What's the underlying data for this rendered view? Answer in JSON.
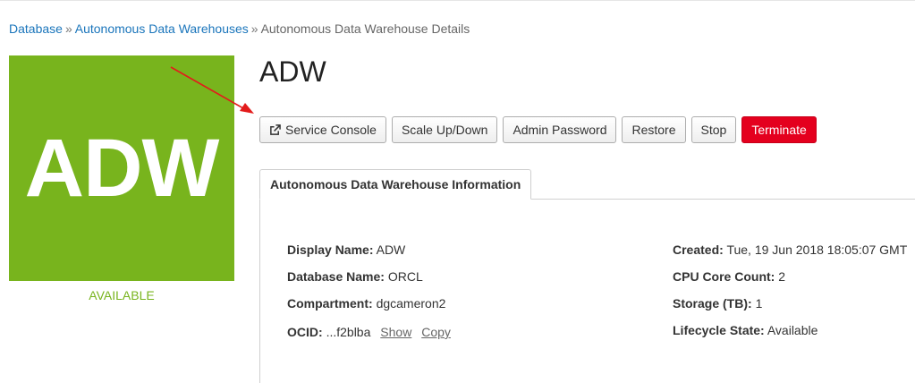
{
  "breadcrumb": {
    "items": [
      "Database",
      "Autonomous Data Warehouses"
    ],
    "separator": "»",
    "current": "Autonomous Data Warehouse Details"
  },
  "tile": {
    "abbr": "ADW",
    "color": "#78b41d"
  },
  "status": {
    "text": "AVAILABLE",
    "color": "#78b41d"
  },
  "title": "ADW",
  "actions": {
    "service_console": "Service Console",
    "scale": "Scale Up/Down",
    "admin_password": "Admin Password",
    "restore": "Restore",
    "stop": "Stop",
    "terminate": "Terminate",
    "terminate_color": "#e4001e"
  },
  "tab": {
    "label": "Autonomous Data Warehouse Information"
  },
  "info": {
    "display_name": {
      "label": "Display Name:",
      "value": "ADW"
    },
    "database_name": {
      "label": "Database Name:",
      "value": "ORCL"
    },
    "compartment": {
      "label": "Compartment:",
      "value": "dgcameron2"
    },
    "ocid": {
      "label": "OCID:",
      "value": "...f2blba",
      "show": "Show",
      "copy": "Copy"
    },
    "created": {
      "label": "Created:",
      "value": "Tue, 19 Jun 2018 18:05:07 GMT"
    },
    "cpu_core_count": {
      "label": "CPU Core Count:",
      "value": "2"
    },
    "storage": {
      "label": "Storage (TB):",
      "value": "1"
    },
    "lifecycle_state": {
      "label": "Lifecycle State:",
      "value": "Available"
    }
  },
  "annotation": {
    "arrow_color": "#e31b1b"
  }
}
